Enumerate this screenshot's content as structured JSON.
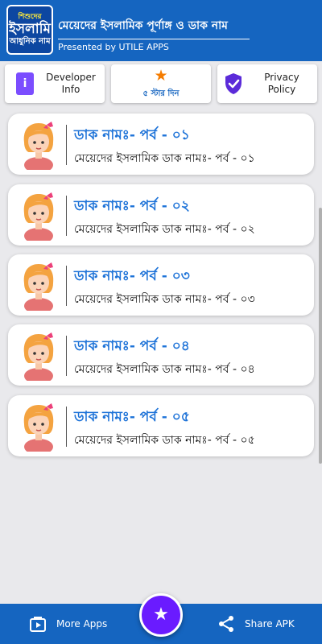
{
  "appbar": {
    "logo_line1": "শিশুদের",
    "logo_line2": "ইসলামি",
    "logo_line3": "আধুনিক নাম",
    "title": "মেয়েদের ইসলামিক পূর্ণাঙ্গ ও ডাক নাম",
    "subtitle": "Presented by UTILE APPS"
  },
  "top_buttons": {
    "developer_label": "Developer\nInfo",
    "developer_icon": "i",
    "rate_label": "৫ স্টার দিন",
    "privacy_label": "Privacy\nPolicy"
  },
  "cards": [
    {
      "title": "ডাক নামঃ- পর্ব - ০১",
      "subtitle": "মেয়েদের ইসলামিক ডাক নামঃ- পর্ব - ০১"
    },
    {
      "title": "ডাক নামঃ- পর্ব - ০২",
      "subtitle": "মেয়েদের ইসলামিক ডাক নামঃ- পর্ব - ০২"
    },
    {
      "title": "ডাক নামঃ- পর্ব - ০৩",
      "subtitle": "মেয়েদের ইসলামিক ডাক নামঃ- পর্ব - ০৩"
    },
    {
      "title": "ডাক নামঃ- পর্ব - ০৪",
      "subtitle": "মেয়েদের ইসলামিক ডাক নামঃ- পর্ব - ০৪"
    },
    {
      "title": "ডাক নামঃ- পর্ব - ০৫",
      "subtitle": "মেয়েদের ইসলামিক ডাক নামঃ- পর্ব - ০৫"
    }
  ],
  "bottom_bar": {
    "more_apps_label": "More Apps",
    "share_label": "Share APK"
  },
  "icons": {
    "developer": "info-icon",
    "rate": "star-icon",
    "privacy": "shield-check-icon",
    "card": "girl-avatar-icon",
    "more_apps": "play-bag-icon",
    "share": "share-icon",
    "fab": "star-icon"
  },
  "colors": {
    "primary": "#1565c0",
    "accent": "#6a1bff",
    "card_title": "#1e73d8",
    "star": "#f57c00",
    "background": "#e9e9ec"
  }
}
